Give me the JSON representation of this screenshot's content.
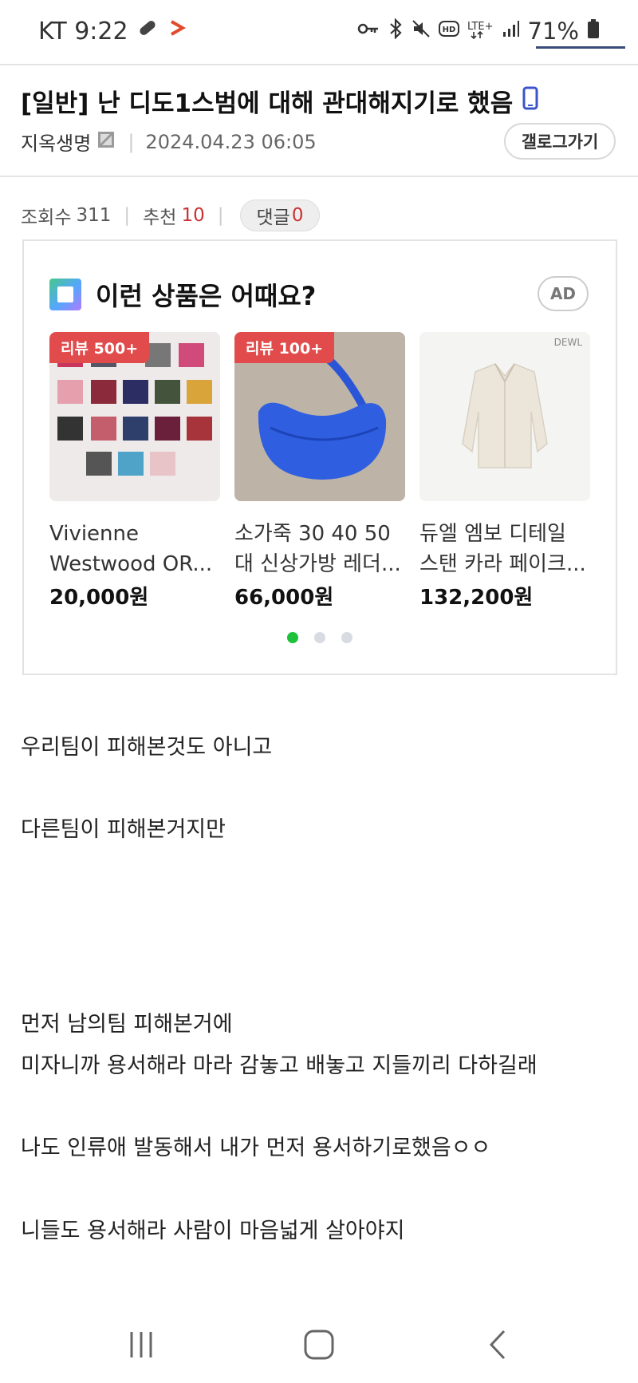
{
  "status_bar": {
    "carrier_time": "KT 9:22",
    "battery": "71%",
    "icons": [
      "pill-icon",
      "flag-icon",
      "key-icon",
      "bluetooth-icon",
      "mute-icon",
      "hd-icon",
      "lte-icon",
      "signal-icon",
      "battery-icon"
    ]
  },
  "post": {
    "title": "[일반] 난 디도1스범에 대해 관대해지기로 했음",
    "author": "지옥생명",
    "date": "2024.04.23 06:05",
    "gallery_button": "갤로그가기",
    "views_label": "조회수",
    "views": "311",
    "recommend_label": "추천",
    "recommend": "10",
    "comments_label": "댓글",
    "comments": "0"
  },
  "ad": {
    "heading": "이런 상품은 어때요?",
    "badge": "AD",
    "products": [
      {
        "tag": "리뷰 500+",
        "name1": "Vivienne",
        "name2": "Westwood OR...",
        "price": "20,000원"
      },
      {
        "tag": "리뷰 100+",
        "name1": "소가죽 30 40 50",
        "name2": "대 신상가방 레더...",
        "price": "66,000원"
      },
      {
        "brand": "DEWL",
        "name1": "듀엘 엠보 디테일",
        "name2": "스탠 카라 페이크...",
        "price": "132,200원"
      }
    ],
    "colors": {
      "tag": "#e14b4b",
      "dot_active": "#1ec13a"
    }
  },
  "body": [
    "우리팀이 피해본것도 아니고",
    "다른팀이 피해본거지만",
    "먼저 남의팀 피해본거에",
    "미자니까 용서해라 마라 감놓고 배놓고 지들끼리 다하길래",
    "나도 인류애 발동해서 내가 먼저 용서하기로했음ㅇㅇ",
    "니들도 용서해라 사람이 마음넓게 살아야지"
  ],
  "nav": [
    "recent-apps-icon",
    "home-icon",
    "back-icon"
  ]
}
